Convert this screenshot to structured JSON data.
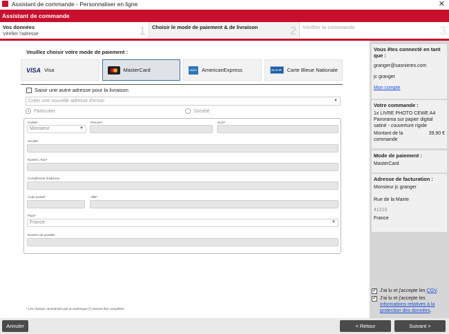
{
  "window": {
    "title": "Assistant de commande - Personnaliser en ligne",
    "close_glyph": "✕"
  },
  "header": {
    "title": "Assistant de commande"
  },
  "steps": [
    {
      "title": "Vos données",
      "subtitle": "Vérifier l'adresse",
      "number": "1"
    },
    {
      "title": "Choisir le mode de paiement & de livraison",
      "number": "2"
    },
    {
      "title": "Vérifier la commande",
      "number": "3"
    }
  ],
  "payment": {
    "heading": "Veuillez choisir votre mode de paiement :",
    "methods": [
      {
        "logo": "VISA",
        "label": "Visa"
      },
      {
        "label": "MasterCard",
        "selected": true
      },
      {
        "logo": "AMEX",
        "label": "AmericanExpress"
      },
      {
        "logo": "BLEUE",
        "label": "Carte Bleue Nationale"
      }
    ]
  },
  "delivery": {
    "checkbox_label": "Saisir une autre adresse pour la livraison",
    "address_select": "Créer une nouvelle adresse d'envoi",
    "radio_private": "Particulier",
    "radio_company": "Société"
  },
  "form": {
    "civility_label": "Civilité*",
    "civility_value": "Monsieur",
    "firstname_label": "Prénom*",
    "lastname_label": "Nom*",
    "company_label": "Société",
    "street_label": "Numéro, Rue*",
    "complement_label": "Complément d'adresse",
    "zip_label": "Code postal*",
    "city_label": "Ville*",
    "country_label": "Pays*",
    "country_value": "France",
    "mobile_label": "Numéro de portable"
  },
  "footnote": "* Les champs caractérisés par un astérisque (*) doivent être complétés.",
  "sidebar": {
    "connected_title": "Vous êtes connecté en tant que :",
    "email": "granger@sasnieres.com",
    "user_name": "jc granger",
    "account_link": "Mon compte",
    "order_title": "Votre commande :",
    "order_item": "1x LIVRE PHOTO CEWE A4 Panorama sur papier digital satiné - couverture rigide",
    "order_amount_label": "Montant de la commande",
    "order_amount": "39,90 €",
    "payment_title": "Mode de paiement :",
    "payment_value": "MasterCard",
    "billing_title": "Adresse de facturation :",
    "billing_name": "Monsieur jc granger",
    "billing_street": "Rue de la Mairie",
    "billing_zip": "41210",
    "billing_country": "France",
    "cgv_prefix": "J'ai lu et j'accepte les ",
    "cgv_link": "CGV",
    "privacy_prefix": "J'ai lu et j'accepte les ",
    "privacy_link": "informations relatives à la protection des données"
  },
  "buttons": {
    "cancel": "Annuler",
    "back": "< Retour",
    "next": "Suivant >"
  },
  "colors": {
    "accent": "#c8102e",
    "selected_border": "#3b6fa6",
    "link": "#1a4fd6",
    "button": "#4a4a4a"
  }
}
